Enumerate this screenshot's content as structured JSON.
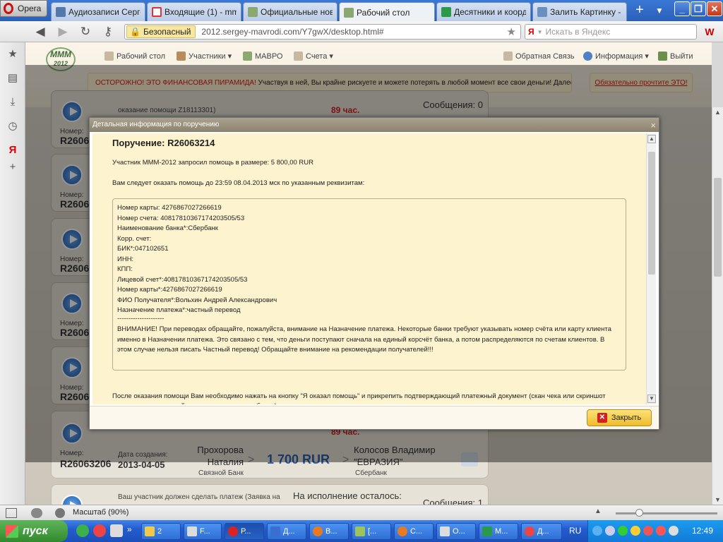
{
  "browser": {
    "menu_label": "Opera",
    "tabs": [
      {
        "title": "Аудиозаписи Серге..."
      },
      {
        "title": "Входящие (1) - mm..."
      },
      {
        "title": "Официальные ново..."
      },
      {
        "title": "Рабочий стол"
      },
      {
        "title": "Десятники и коорд..."
      },
      {
        "title": "Залить Картинку - ..."
      }
    ],
    "new_tab": "+",
    "security_label": "Безопасный",
    "url": "2012.sergey-mavrodi.com/Y7gwX/desktop.html#",
    "search_placeholder": "Искать в Яндекс",
    "search_engine": "Я"
  },
  "site": {
    "logo": "MMM",
    "logo_year": "2012",
    "nav": [
      {
        "label": "Рабочий стол"
      },
      {
        "label": "Участники ▾"
      },
      {
        "label": "МАВРО"
      },
      {
        "label": "Счета ▾"
      },
      {
        "label": "Обратная Связь"
      },
      {
        "label": "Информация ▾"
      },
      {
        "label": "Выйти"
      }
    ],
    "warning_red": "ОСТОРОЖНО! ЭТО ФИНАНСОВАЯ ПИРАМИДА!",
    "warning_text": " Участвуя в ней, Вы крайне рискуете и можете потерять в любой момент все свои деньги! Далее...",
    "warning_link": "Обязательно прочтите ЭТО!"
  },
  "cards": [
    {
      "num_label": "Номер:",
      "num": "R2606",
      "note": "оказание помощи Z18113301)",
      "timer": "89 час.",
      "msgs": "Сообщения: 0"
    },
    {
      "num_label": "Номер:",
      "num": "R2606"
    },
    {
      "num_label": "Номер:",
      "num": "R2606"
    },
    {
      "num_label": "Номер:",
      "num": "R2606"
    },
    {
      "num_label": "Номер:",
      "num": "R2606"
    },
    {
      "num_label": "Номер:",
      "num": "R26063206",
      "created_label": "Дата создания:",
      "created": "2013-04-05",
      "from_name": "Прохорова Наталия",
      "from_bank": "Связной Банк",
      "amount": "1 700 RUR",
      "to_name": "Колосов Владимир \"ЕВРАЗИЯ\"",
      "to_bank": "Сбербанк",
      "timer": "89 час."
    },
    {
      "note": "Ваш участник должен сделать платеж (Заявка на",
      "remaining": "На исполнение осталось:",
      "msgs": "Сообщения: 1"
    }
  ],
  "modal": {
    "title": "Детальная информация по поручению",
    "close_x": "×",
    "order": "Поручение: R26063214",
    "line1": "Участник МММ-2012 запросил помощь в размере: 5 800,00 RUR",
    "line2": "Вам следует оказать помощь до 23:59 08.04.2013 мск по указанным реквизитам:",
    "requisites": [
      "Номер карты: 4276867027266619",
      "Номер счета: 40817810367174203505/53",
      "Наименование банка*:Сбербанк",
      "Корр. счет:",
      "БИК*:047102651",
      "ИНН:",
      "КПП:",
      "Лицевой счет*:40817810367174203505/53",
      "Номер карты*:4276867027266619",
      "ФИО Получателя*:Вольхин Андрей Александрович",
      "Назначение платежа*:частный перевод",
      "---------------------"
    ],
    "note": "ВНИМАНИЕ! При переводах обращайте, пожалуйста, внимание на Назначение платежа. Некоторые банки требуют указывать номер счёта или карту клиента именно в Назначении платежа. Это связано с тем, что деньги поступают сначала на единый корсчёт банка, а потом распределяются по счетам клиентов. В этом случае нельзя писать Частный перевод! Обращайте внимание на рекомендации получателей!!!",
    "after": "После оказания помощи Вам необходимо нажать на кнопку \"Я оказал помощь\" и прикрепить подтверждающий платежный документ (скан чека или скриншот страницы проведенной при помощи интернет банка) с реквизитами отправителя.",
    "close_button": "Закрыть"
  },
  "status": {
    "zoom": "Масштаб (90%)"
  },
  "taskbar": {
    "start": "пуск",
    "buttons": [
      {
        "label": "2"
      },
      {
        "label": "F..."
      },
      {
        "label": "Р..."
      },
      {
        "label": "Д..."
      },
      {
        "label": "В..."
      },
      {
        "label": "[..."
      },
      {
        "label": "С..."
      },
      {
        "label": "О..."
      },
      {
        "label": "М..."
      },
      {
        "label": "Д..."
      }
    ],
    "lang": "RU",
    "clock": "12:49"
  }
}
